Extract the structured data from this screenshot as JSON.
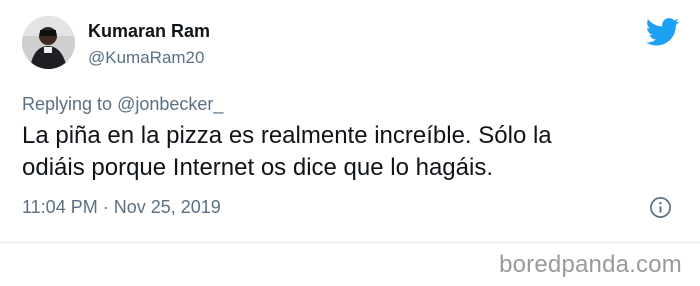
{
  "tweet": {
    "author_name": "Kumaran Ram",
    "author_handle": "@KumaRam20",
    "replying_prefix": "Replying to ",
    "replying_to": "@jonbecker_",
    "text": "La piña en la pizza es realmente increíble. Sólo la\nodiáis porque Internet os dice que lo hagáis.",
    "timestamp": "11:04 PM · Nov 25, 2019",
    "icons": {
      "brand": "twitter-bird-icon",
      "info": "info-icon"
    },
    "colors": {
      "brand": "#1da1f2",
      "secondary_text": "#5b7083",
      "primary_text": "#0f1419"
    }
  },
  "watermark": {
    "text": "boredpanda.com",
    "color": "#9a9a9a"
  }
}
